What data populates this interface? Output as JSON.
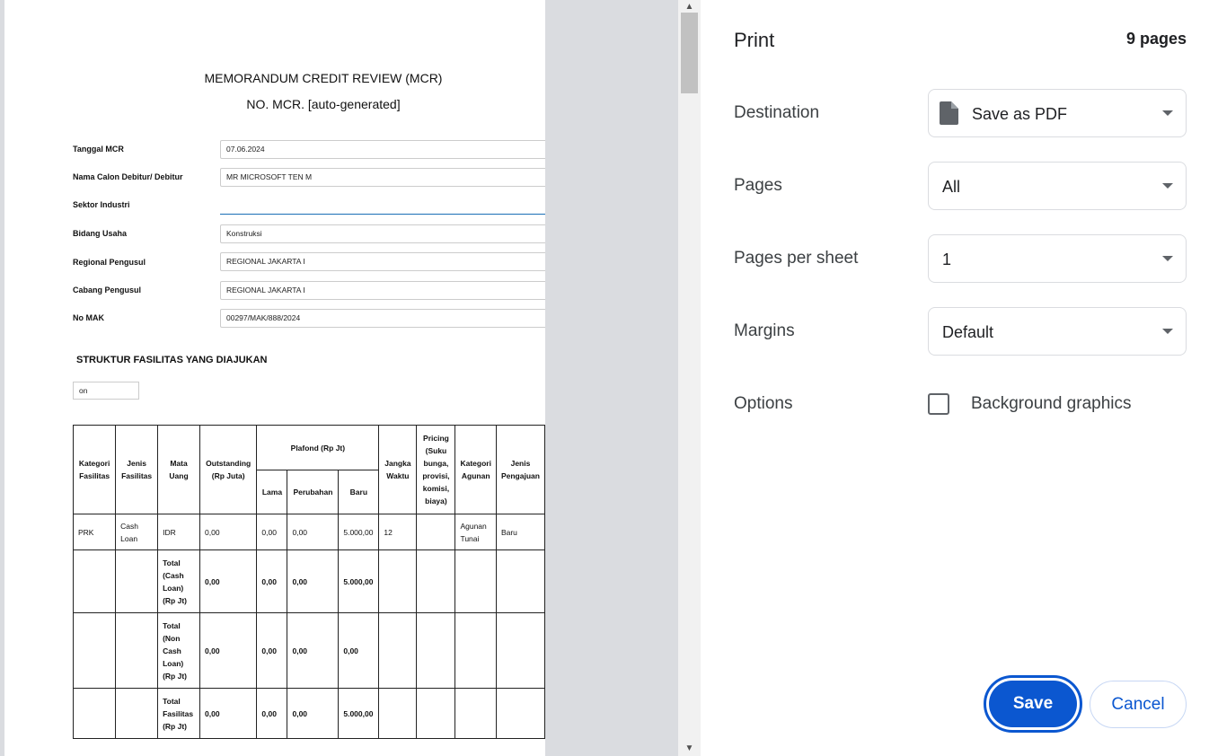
{
  "document": {
    "title": "MEMORANDUM CREDIT REVIEW (MCR)",
    "number": "NO. MCR. [auto-generated]",
    "fields": [
      {
        "label": "Tanggal MCR",
        "value": "07.06.2024"
      },
      {
        "label": "Nama Calon Debitur/ Debitur",
        "value": "MR MICROSOFT TEN M"
      },
      {
        "label": "Sektor Industri",
        "value": ""
      },
      {
        "label": "Bidang Usaha",
        "value": "Konstruksi"
      },
      {
        "label": "Regional Pengusul",
        "value": "REGIONAL JAKARTA I"
      },
      {
        "label": "Cabang Pengusul",
        "value": "REGIONAL JAKARTA I"
      },
      {
        "label": "No MAK",
        "value": "00297/MAK/888/2024"
      }
    ],
    "section_title": "STRUKTUR FASILITAS YANG DIAJUKAN",
    "small_input_value": "on",
    "table": {
      "headers": {
        "kategori": "Kategori Fasilitas",
        "jenis": "Jenis Fasilitas",
        "mata_uang": "Mata Uang",
        "outstanding": "Outstanding (Rp Juta)",
        "plafond": "Plafond (Rp Jt)",
        "lama": "Lama",
        "perubahan": "Perubahan",
        "baru": "Baru",
        "jangka": "Jangka Waktu",
        "pricing": "Pricing (Suku bunga, provisi, komisi, biaya)",
        "kategori_agunan": "Kategori Agunan",
        "jenis_pengajuan": "Jenis Pengajuan"
      },
      "rows": [
        {
          "kategori": "PRK",
          "jenis": "Cash Loan",
          "mata_uang": "IDR",
          "outstanding": "0,00",
          "lama": "0,00",
          "perubahan": "0,00",
          "baru": "5.000,00",
          "jangka": "12",
          "pricing": "",
          "kategori_agunan": "Agunan Tunai",
          "jenis_pengajuan": "Baru"
        },
        {
          "kategori": "",
          "jenis": "",
          "mata_uang": "Total (Cash Loan) (Rp Jt)",
          "outstanding": "0,00",
          "lama": "0,00",
          "perubahan": "0,00",
          "baru": "5.000,00",
          "jangka": "",
          "pricing": "",
          "kategori_agunan": "",
          "jenis_pengajuan": ""
        },
        {
          "kategori": "",
          "jenis": "",
          "mata_uang": "Total (Non Cash Loan) (Rp Jt)",
          "outstanding": "0,00",
          "lama": "0,00",
          "perubahan": "0,00",
          "baru": "0,00",
          "jangka": "",
          "pricing": "",
          "kategori_agunan": "",
          "jenis_pengajuan": ""
        },
        {
          "kategori": "",
          "jenis": "",
          "mata_uang": "Total Fasilitas (Rp Jt)",
          "outstanding": "0,00",
          "lama": "0,00",
          "perubahan": "0,00",
          "baru": "5.000,00",
          "jangka": "",
          "pricing": "",
          "kategori_agunan": "",
          "jenis_pengajuan": ""
        }
      ]
    }
  },
  "print_panel": {
    "title": "Print",
    "page_count": "9 pages",
    "destination": {
      "label": "Destination",
      "value": "Save as PDF",
      "icon": "file-icon"
    },
    "pages": {
      "label": "Pages",
      "value": "All"
    },
    "pages_per_sheet": {
      "label": "Pages per sheet",
      "value": "1"
    },
    "margins": {
      "label": "Margins",
      "value": "Default"
    },
    "options": {
      "label": "Options",
      "checkbox_label": "Background graphics",
      "checked": false
    },
    "save_label": "Save",
    "cancel_label": "Cancel",
    "accent_color": "#0b57d0"
  }
}
